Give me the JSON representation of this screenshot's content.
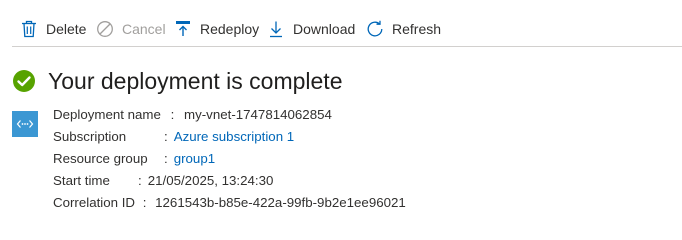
{
  "toolbar": {
    "delete_label": "Delete",
    "cancel_label": "Cancel",
    "redeploy_label": "Redeploy",
    "download_label": "Download",
    "refresh_label": "Refresh"
  },
  "title": "Your deployment is complete",
  "details": {
    "deployment_name_label": "Deployment name",
    "deployment_name_value": "my-vnet-1747814062854",
    "subscription_label": "Subscription",
    "subscription_value": "Azure subscription 1",
    "resource_group_label": "Resource group",
    "resource_group_value": "group1",
    "start_time_label": "Start time",
    "start_time_value": "21/05/2025, 13:24:30",
    "correlation_id_label": "Correlation ID",
    "correlation_id_value": "1261543b-b85e-422a-99fb-9b2e1ee96021",
    "separator": ":"
  },
  "colors": {
    "accent": "#0067b8",
    "success": "#57a300",
    "resource_icon_bg": "#3b97d3",
    "disabled_text": "#a19f9d"
  },
  "icons": [
    "trash-icon",
    "cancel-icon",
    "redeploy-icon",
    "download-icon",
    "refresh-icon",
    "success-check-icon",
    "resource-vnet-icon"
  ]
}
